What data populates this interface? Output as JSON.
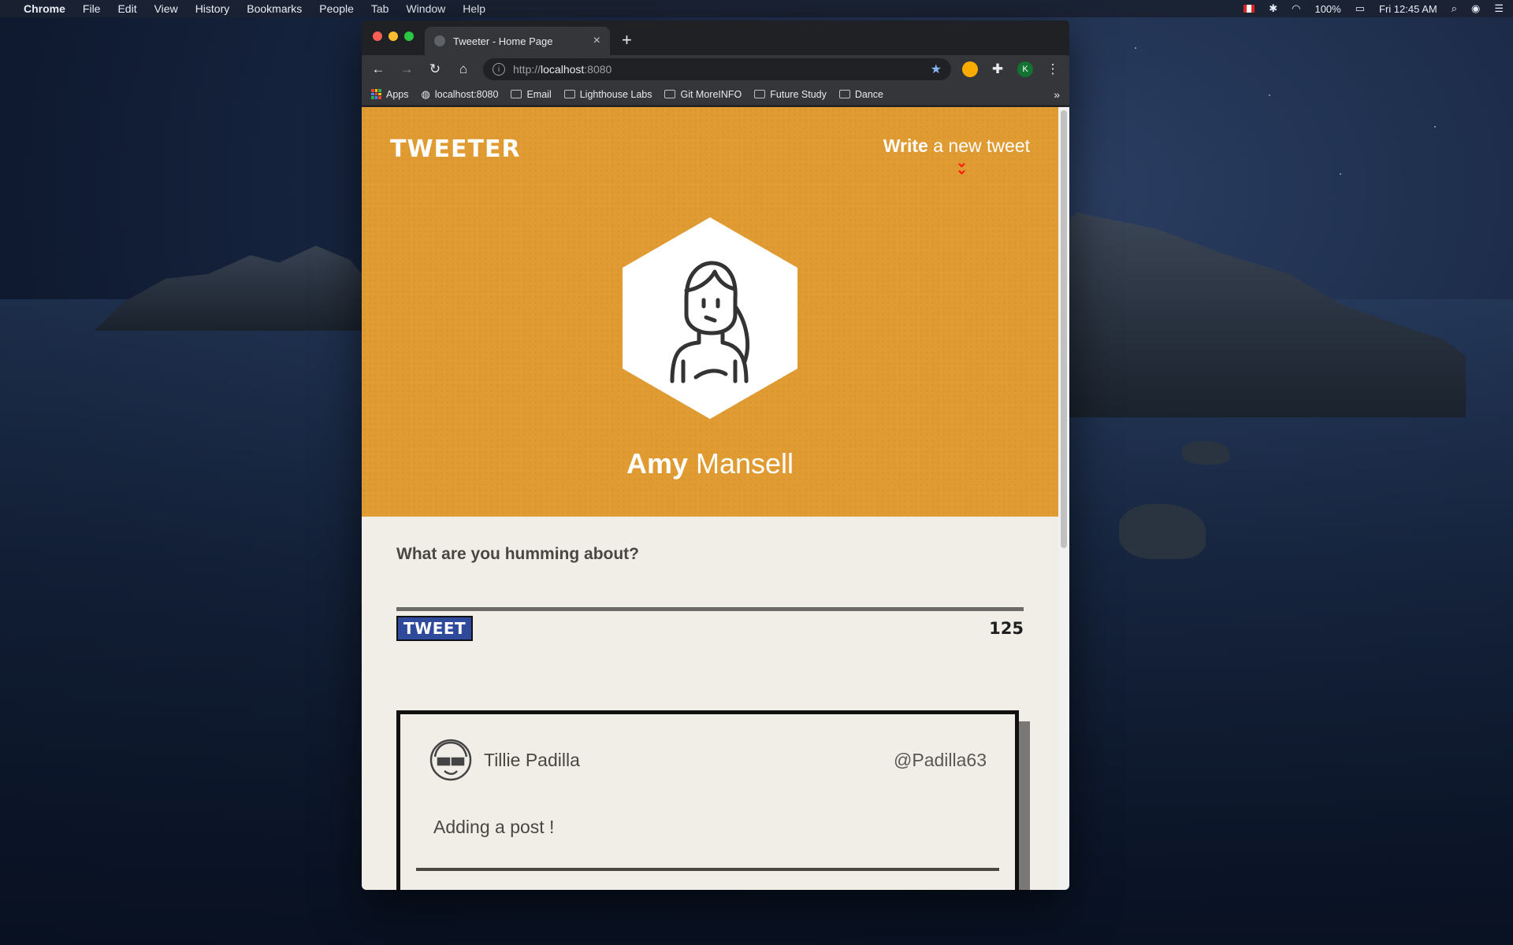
{
  "menubar": {
    "app": "Chrome",
    "items": [
      "File",
      "Edit",
      "View",
      "History",
      "Bookmarks",
      "People",
      "Tab",
      "Window",
      "Help"
    ],
    "battery": "100%",
    "clock": "Fri 12:45 AM"
  },
  "browser": {
    "tab_title": "Tweeter - Home Page",
    "url_scheme": "http://",
    "url_host": "localhost",
    "url_port": ":8080",
    "profile_initial": "K",
    "bookmarks": [
      {
        "label": "Apps",
        "icon": "apps-grid-icon"
      },
      {
        "label": "localhost:8080",
        "icon": "globe-icon"
      },
      {
        "label": "Email",
        "icon": "folder-icon"
      },
      {
        "label": "Lighthouse Labs",
        "icon": "folder-icon"
      },
      {
        "label": "Git MoreINFO",
        "icon": "folder-icon"
      },
      {
        "label": "Future Study",
        "icon": "folder-icon"
      },
      {
        "label": "Dance",
        "icon": "folder-icon"
      }
    ],
    "bookmarks_overflow": "»"
  },
  "page": {
    "logo": "TWEETER",
    "write_link_bold": "Write",
    "write_link_rest": " a new tweet",
    "profile_first": "Amy",
    "profile_last": " Mansell",
    "compose_label": "What are you humming about?",
    "tweet_button": "TWEET",
    "counter": "125",
    "colors": {
      "header": "#e09c32",
      "page_bg": "#f1eee8",
      "tweet_button": "#2f4a9a",
      "chevron": "#ff1b0e"
    }
  },
  "tweet": {
    "name": "Tillie Padilla",
    "handle": "@Padilla63",
    "text": "Adding a post !",
    "actions": [
      "flag-icon",
      "retweet-icon",
      "heart-icon"
    ]
  }
}
